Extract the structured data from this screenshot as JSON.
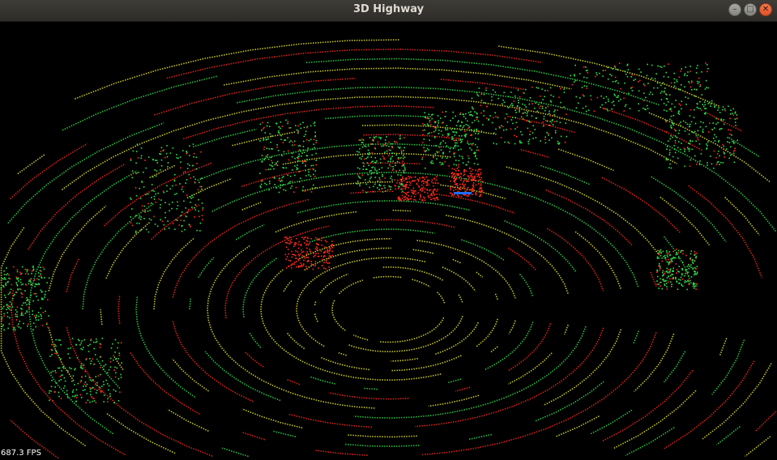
{
  "window": {
    "title": "3D Highway",
    "buttons": {
      "minimize": "–",
      "maximize": "□",
      "close": "✕"
    }
  },
  "viewer": {
    "fps_text": "687.3 FPS",
    "point_colors": {
      "near": "#ff2a1a",
      "mid": "#e6e62a",
      "far": "#2fe04a",
      "ego_marker": "#1e6cff"
    }
  }
}
